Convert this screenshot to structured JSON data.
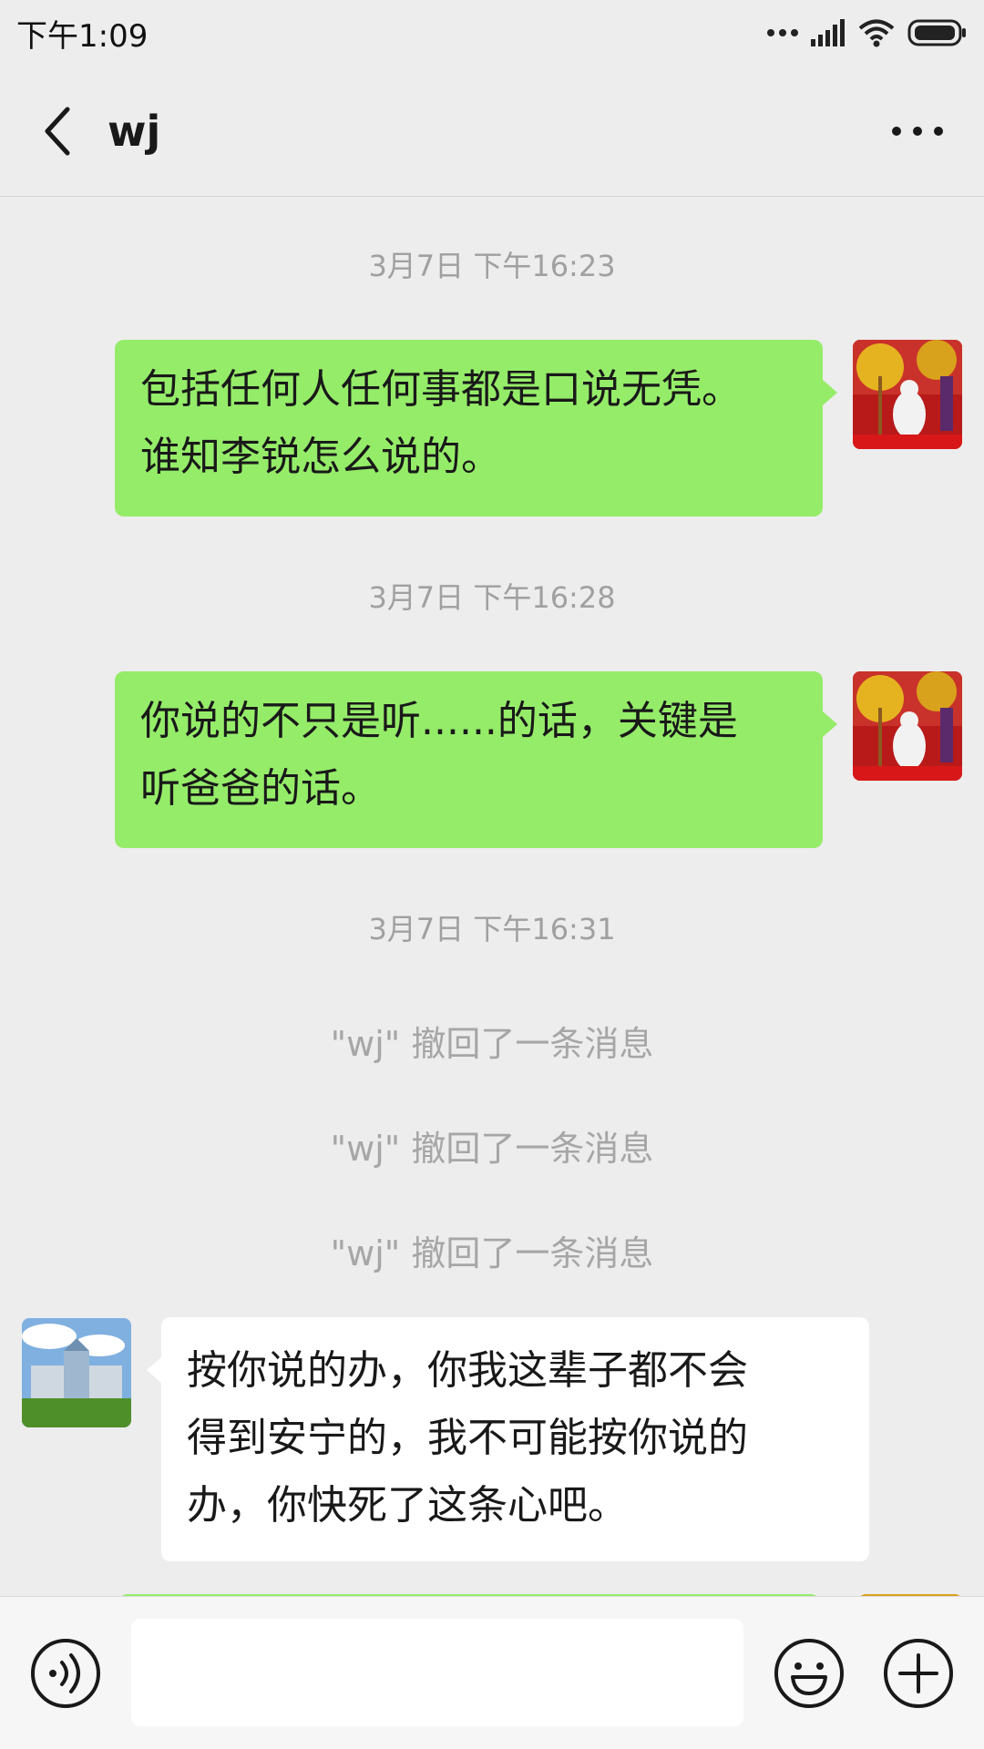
{
  "status_bar": {
    "time": "下午1:09",
    "icons": [
      "more-dots-icon",
      "signal-icon",
      "wifi-icon",
      "battery-icon"
    ]
  },
  "header": {
    "title": "wj",
    "back_icon": "back-chevron-icon",
    "more_icon": "more-icon"
  },
  "messages": [
    {
      "type": "timestamp",
      "text": "3月7日 下午16:23"
    },
    {
      "type": "outgoing",
      "lines": [
        "包括任何人任何事都是口说无凭。",
        "谁知李锐怎么说的。"
      ]
    },
    {
      "type": "timestamp",
      "text": "3月7日 下午16:28"
    },
    {
      "type": "outgoing",
      "lines": [
        "你说的不只是听......的话，关键是",
        "听爸爸的话。"
      ]
    },
    {
      "type": "timestamp",
      "text": "3月7日 下午16:31"
    },
    {
      "type": "system",
      "text": "\"wj\" 撤回了一条消息"
    },
    {
      "type": "system",
      "text": "\"wj\" 撤回了一条消息"
    },
    {
      "type": "system",
      "text": "\"wj\" 撤回了一条消息"
    },
    {
      "type": "incoming",
      "lines": [
        "按你说的办，你我这辈子都不会",
        "得到安宁的，我不可能按你说的",
        "办，你快死了这条心吧。"
      ]
    }
  ],
  "input_bar": {
    "value": "",
    "voice_icon": "voice-icon",
    "emoji_icon": "emoji-icon",
    "plus_icon": "plus-icon"
  },
  "colors": {
    "background": "#ededed",
    "outgoing_bubble": "#95ec69",
    "incoming_bubble": "#ffffff",
    "system_text": "#a6a6a6"
  }
}
